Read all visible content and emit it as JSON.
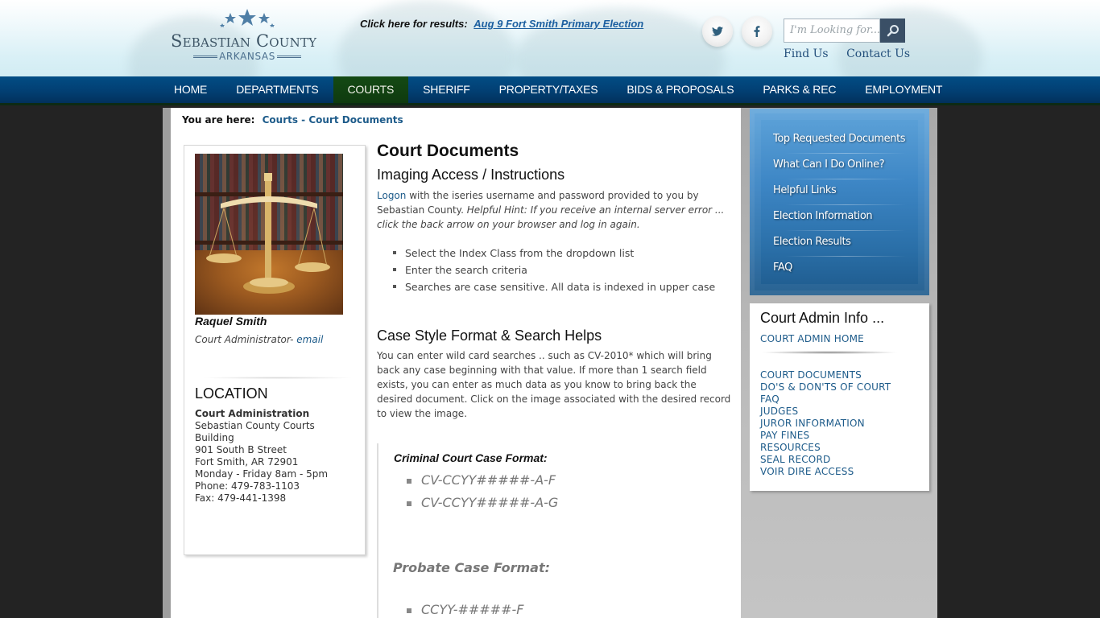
{
  "header": {
    "logo": {
      "name": "Sebastian County",
      "state": "ARKANSAS"
    },
    "results_banner": {
      "prefix": "Click here for results:",
      "link": "Aug 9 Fort Smith Primary Election"
    },
    "social": [
      {
        "icon": "twitter-icon",
        "glyph": "t"
      },
      {
        "icon": "facebook-icon",
        "glyph": "f"
      }
    ],
    "search": {
      "placeholder": "I'm Looking for...",
      "button_icon": "search-icon"
    },
    "links": [
      "Find Us",
      "Contact Us"
    ]
  },
  "nav": {
    "items": [
      "HOME",
      "DEPARTMENTS",
      "COURTS",
      "SHERIFF",
      "PROPERTY/TAXES",
      "BIDS & PROPOSALS",
      "PARKS & REC",
      "EMPLOYMENT"
    ],
    "active": "COURTS"
  },
  "breadcrumb": {
    "label": "You are here:",
    "path": "Courts - Court Documents"
  },
  "staff": {
    "name": "Raquel Smith",
    "title": "Court Administrator-",
    "email_link": "email"
  },
  "location": {
    "heading": "LOCATION",
    "office": "Court Administration",
    "lines": [
      "Sebastian County Courts",
      "Building",
      "901 South B Street",
      "Fort Smith, AR 72901",
      "Monday - Friday 8am - 5pm",
      "Phone: 479-783-1103",
      "Fax: 479-441-1398"
    ]
  },
  "main": {
    "title": "Court Documents",
    "section1": {
      "heading": "Imaging Access / Instructions",
      "logon_link": "Logon",
      "text": " with the iseries username and password provided to you by Sebastian County.  ",
      "hint": "Helpful Hint:  If you receive an internal server error ... click the back arrow on your browser and log in again.",
      "bullets": [
        "Select the Index Class from the dropdown list",
        "Enter the search criteria",
        "Searches are case sensitive.  All data is indexed in upper case"
      ]
    },
    "section2": {
      "heading": "Case Style Format & Search Helps",
      "text": "You can enter wild card searches .. such as CV-2010* which will bring back any case beginning with that value.  If more than 1 search field exists, you can enter as much data as you know to bring back the desired document.  Click on the image associated with the desired record to view the image."
    },
    "criminal": {
      "heading": "Criminal Court Case Format:",
      "formats": [
        "CV-CCYY#####-A-F",
        "CV-CCYY#####-A-G"
      ]
    },
    "probate": {
      "heading": "Probate Case Format:",
      "formats": [
        "CCYY-#####-F"
      ]
    }
  },
  "quicklinks": [
    "Top Requested Documents",
    "What Can I Do Online?",
    "Helpful Links",
    "Election Information",
    "Election Results",
    "FAQ"
  ],
  "admin_info": {
    "title": "Court Admin Info ...",
    "home_link": "COURT ADMIN HOME",
    "links": [
      "COURT DOCUMENTS",
      "DO'S & DON'TS OF COURT",
      "FAQ",
      "JUDGES",
      "JUROR INFORMATION",
      "PAY FINES",
      "RESOURCES",
      "SEAL RECORD",
      "VOIR DIRE ACCESS"
    ]
  },
  "colors": {
    "nav_blue": "#024d85",
    "nav_active_green": "#144a14",
    "link_blue": "#1d5b8a",
    "panel_blue": "#3d86c5",
    "search_button": "#3a4f66"
  }
}
